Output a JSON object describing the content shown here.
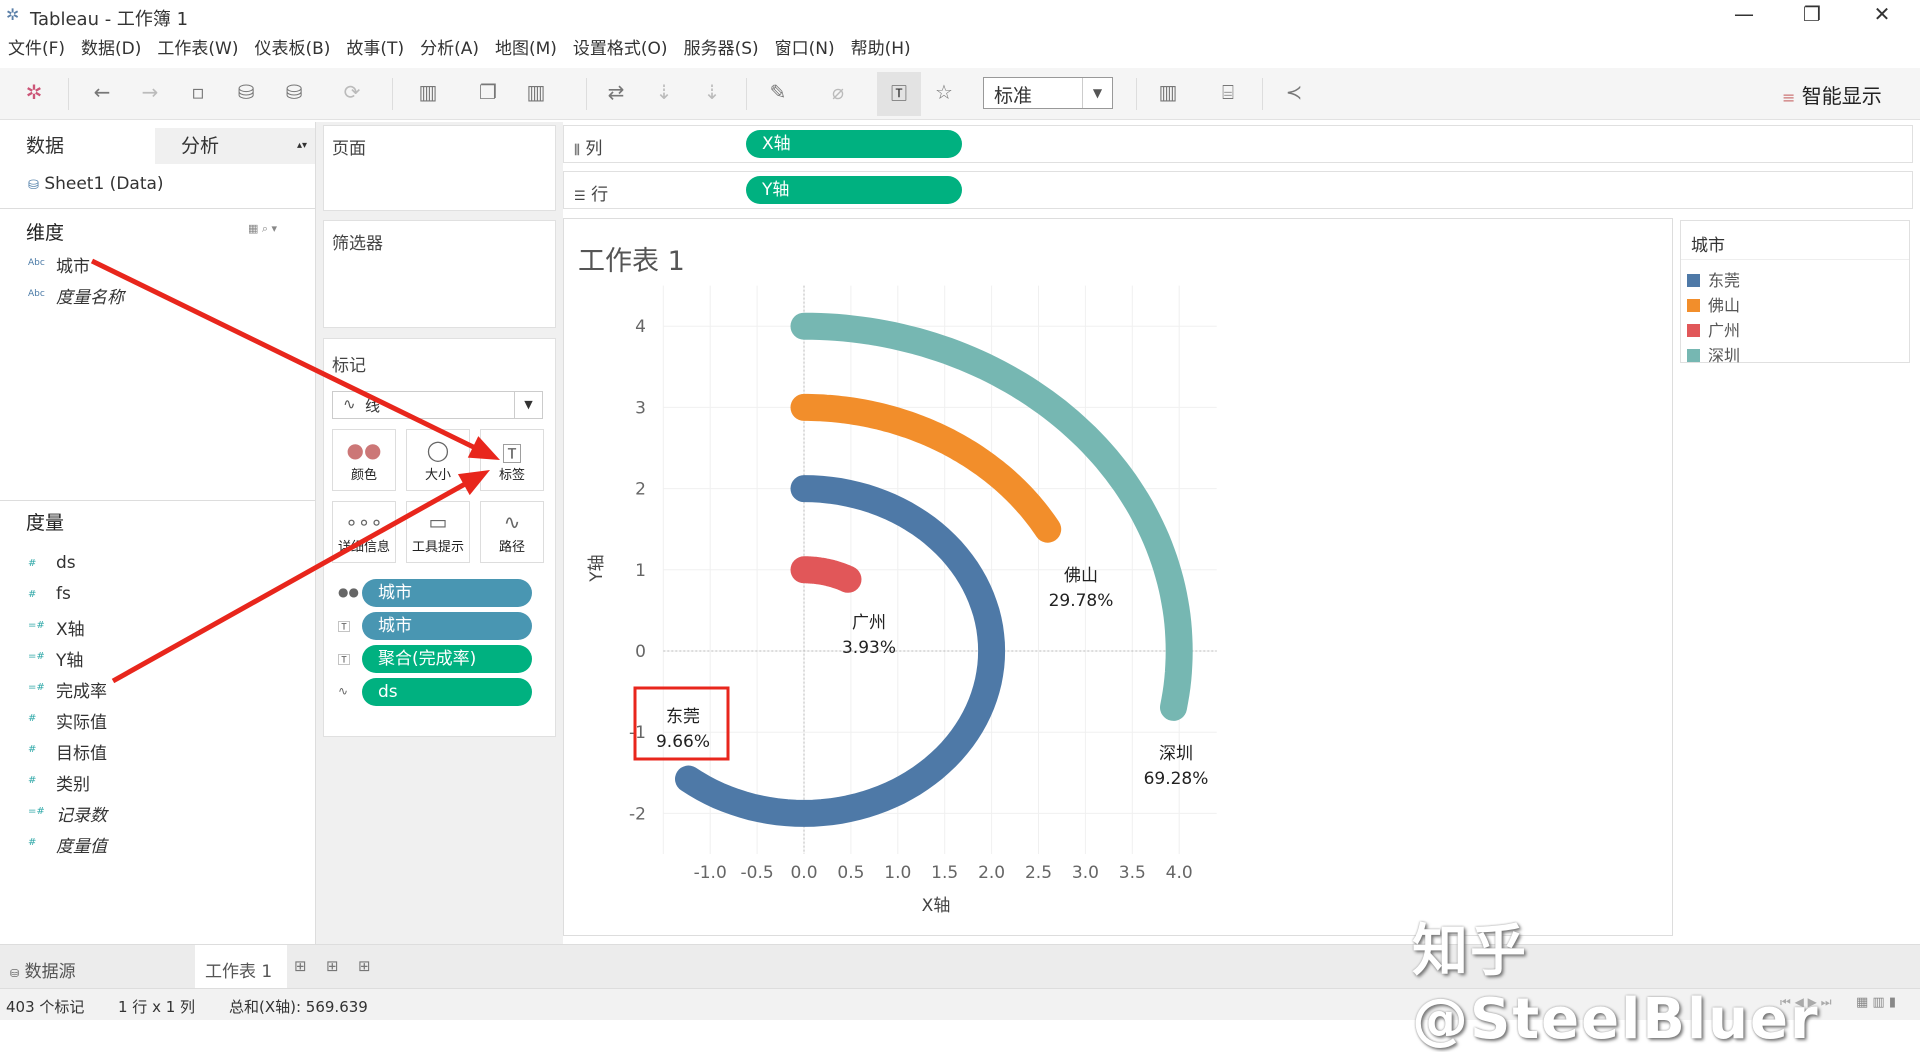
{
  "window": {
    "title": "Tableau - 工作簿 1",
    "minimize": "—",
    "restore": "❐",
    "close": "✕"
  },
  "menu": [
    "文件(F)",
    "数据(D)",
    "工作表(W)",
    "仪表板(B)",
    "故事(T)",
    "分析(A)",
    "地图(M)",
    "设置格式(O)",
    "服务器(S)",
    "窗口(N)",
    "帮助(H)"
  ],
  "toolbar": {
    "fit_select": "标准",
    "smart_show": "智能显示"
  },
  "left": {
    "tab_data": "数据",
    "tab_analysis": "分析",
    "datasource": "Sheet1 (Data)",
    "dimensions_title": "维度",
    "dimensions": [
      "城市",
      "度量名称"
    ],
    "measures_title": "度量",
    "measures": [
      "ds",
      "fs",
      "X轴",
      "Y轴",
      "完成率",
      "实际值",
      "目标值",
      "类别",
      "记录数",
      "度量值"
    ]
  },
  "cards": {
    "pages": "页面",
    "filters": "筛选器",
    "marks": "标记",
    "mark_type": "线",
    "buttons": [
      "颜色",
      "大小",
      "标签",
      "详细信息",
      "工具提示",
      "路径"
    ],
    "pills": [
      "城市",
      "城市",
      "聚合(完成率)",
      "ds"
    ]
  },
  "shelves": {
    "columns_label": "列",
    "columns_pill": "X轴",
    "rows_label": "行",
    "rows_pill": "Y轴"
  },
  "view": {
    "title": "工作表 1"
  },
  "legend": {
    "title": "城市",
    "items": [
      {
        "name": "东莞",
        "color": "#4e79a7"
      },
      {
        "name": "佛山",
        "color": "#f28e2b"
      },
      {
        "name": "广州",
        "color": "#e15759"
      },
      {
        "name": "深圳",
        "color": "#76b7b2"
      }
    ]
  },
  "chart_data": {
    "type": "line",
    "xlabel": "X轴",
    "ylabel": "Y轴",
    "xlim": [
      -1.5,
      4.4
    ],
    "ylim": [
      -2.5,
      4.5
    ],
    "xticks": [
      "-1.0",
      "-0.5",
      "0.0",
      "0.5",
      "1.0",
      "1.5",
      "2.0",
      "2.5",
      "3.0",
      "3.5",
      "4.0"
    ],
    "yticks": [
      "4",
      "3",
      "2",
      "1",
      "0",
      "-1",
      "-2"
    ],
    "grid": true,
    "series": [
      {
        "name": "东莞",
        "color": "#4e79a7",
        "radius": 2,
        "start_angle_deg": 90,
        "end_angle_deg": -128,
        "label": "东莞",
        "value_label": "9.66%",
        "highlighted": true
      },
      {
        "name": "佛山",
        "color": "#f28e2b",
        "radius": 3,
        "start_angle_deg": 90,
        "end_angle_deg": 30,
        "label": "佛山",
        "value_label": "29.78%"
      },
      {
        "name": "广州",
        "color": "#e15759",
        "radius": 1,
        "start_angle_deg": 90,
        "end_angle_deg": 62,
        "label": "广州",
        "value_label": "3.93%"
      },
      {
        "name": "深圳",
        "color": "#76b7b2",
        "radius": 4,
        "start_angle_deg": 90,
        "end_angle_deg": -10,
        "label": "深圳",
        "value_label": "69.28%"
      }
    ]
  },
  "bottom_tabs": {
    "datasource": "数据源",
    "sheet": "工作表 1"
  },
  "status": {
    "marks": "403 个标记",
    "rowscols": "1 行 x 1 列",
    "sum": "总和(X轴): 569.639"
  },
  "watermark": "知乎 @SteelBluer"
}
